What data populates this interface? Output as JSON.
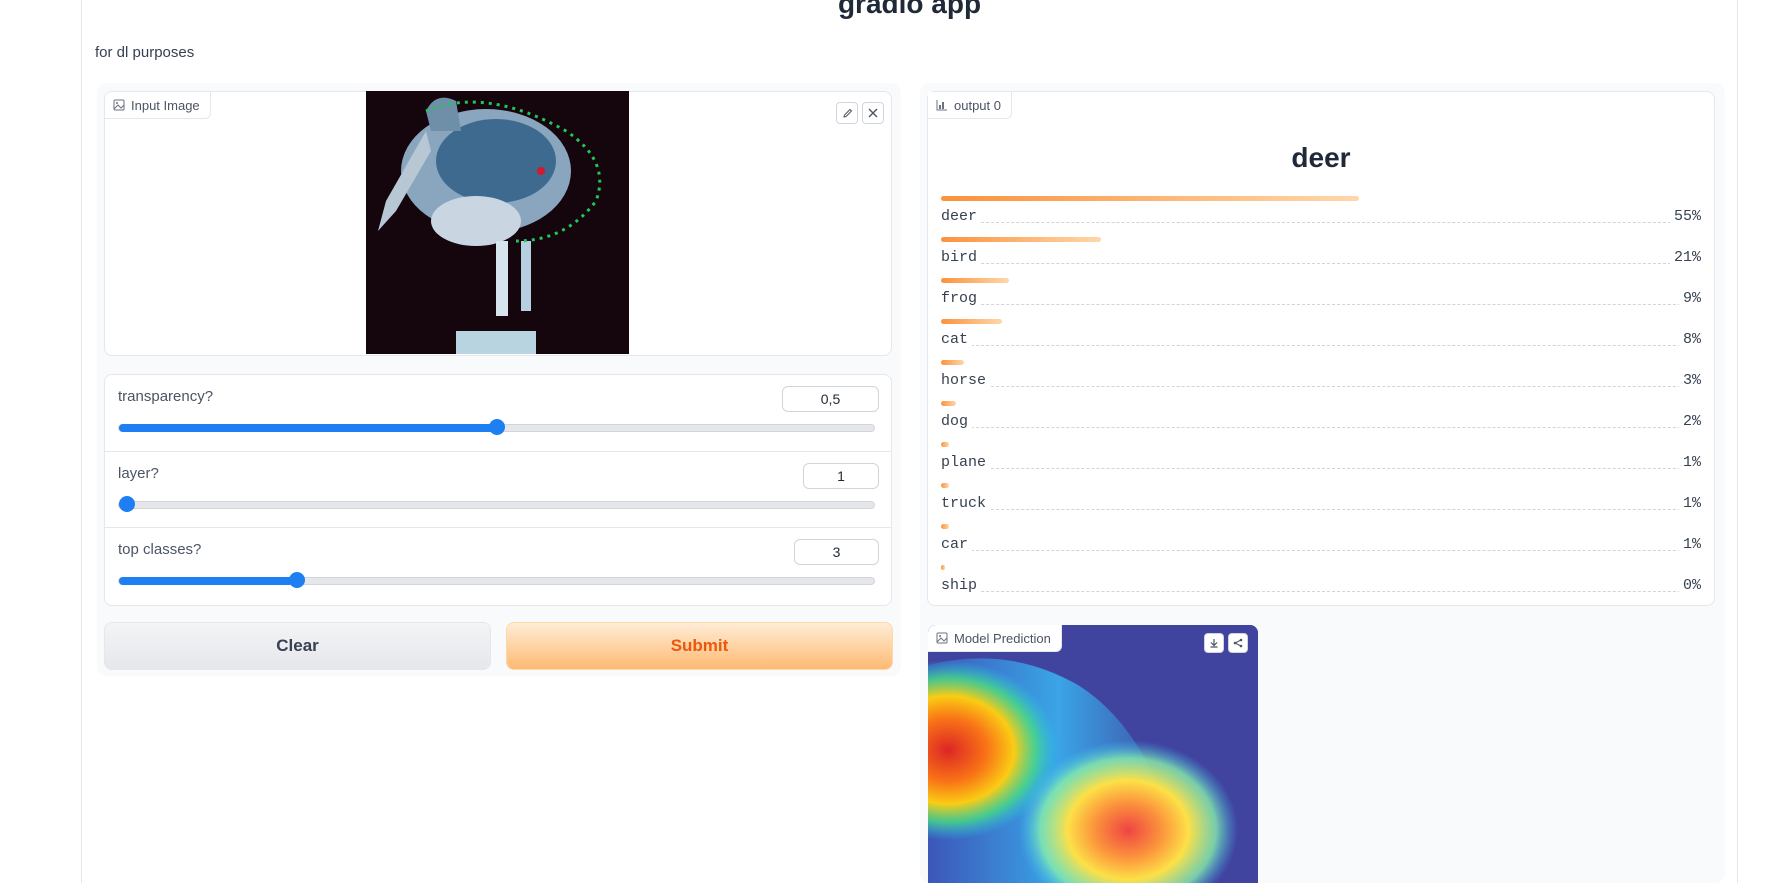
{
  "app": {
    "title": "gradio app",
    "description": "for dl purposes"
  },
  "input_image": {
    "label": "Input Image",
    "edit_icon": "pencil-icon",
    "clear_icon": "close-icon"
  },
  "sliders": [
    {
      "label": "transparency?",
      "value": "0,5",
      "fraction": 0.5
    },
    {
      "label": "layer?",
      "value": "1",
      "fraction": 0.0
    },
    {
      "label": "top classes?",
      "value": "3",
      "fraction": 0.23
    }
  ],
  "buttons": {
    "clear": "Clear",
    "submit": "Submit"
  },
  "output": {
    "label": "output 0",
    "predicted": "deer",
    "confidences": [
      {
        "label": "deer",
        "pct": "55%",
        "value": 0.55
      },
      {
        "label": "bird",
        "pct": "21%",
        "value": 0.21
      },
      {
        "label": "frog",
        "pct": "9%",
        "value": 0.09
      },
      {
        "label": "cat",
        "pct": "8%",
        "value": 0.08
      },
      {
        "label": "horse",
        "pct": "3%",
        "value": 0.03
      },
      {
        "label": "dog",
        "pct": "2%",
        "value": 0.02
      },
      {
        "label": "plane",
        "pct": "1%",
        "value": 0.01
      },
      {
        "label": "truck",
        "pct": "1%",
        "value": 0.01
      },
      {
        "label": "car",
        "pct": "1%",
        "value": 0.01
      },
      {
        "label": "ship",
        "pct": "0%",
        "value": 0.004
      }
    ]
  },
  "model_prediction": {
    "label": "Model Prediction",
    "download_icon": "download-icon",
    "share_icon": "share-icon"
  },
  "colors": {
    "accent": "#1d7ff2",
    "submit_text": "#ea580c",
    "bar": "#fb923c"
  }
}
